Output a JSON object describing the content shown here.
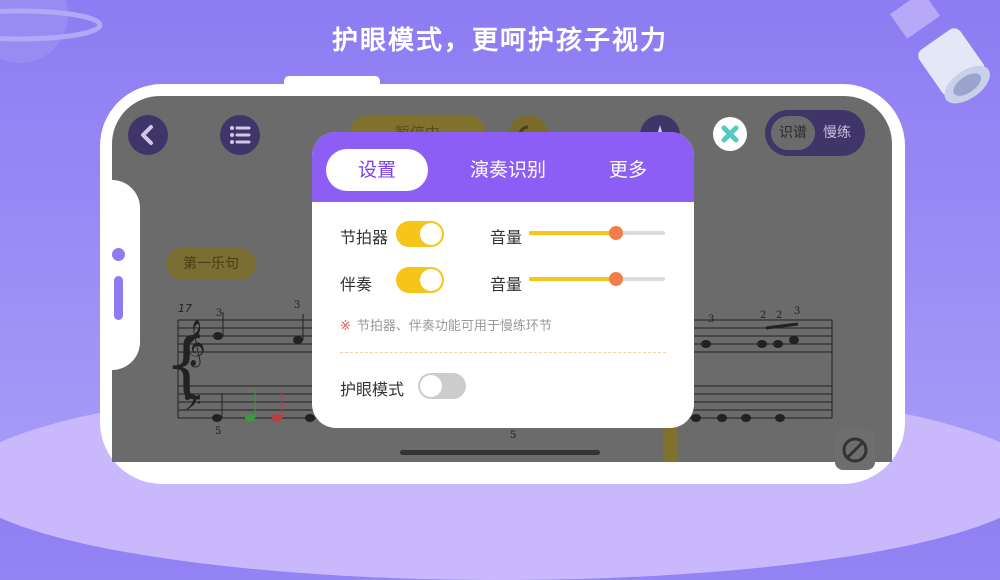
{
  "headline": "护眼模式，更呵护孩子视力",
  "app": {
    "status_pill": "暂停中",
    "mode_toggle": {
      "options": [
        "识谱",
        "慢练"
      ],
      "selected": "识谱"
    },
    "phrase_label": "第一乐句",
    "bar_number": "17"
  },
  "dialog": {
    "tabs": [
      {
        "label": "设置",
        "active": true
      },
      {
        "label": "演奏识别",
        "active": false
      },
      {
        "label": "更多",
        "active": false
      }
    ],
    "rows": [
      {
        "label": "节拍器",
        "enabled": true,
        "volume_label": "音量",
        "volume": 0.64
      },
      {
        "label": "伴奏",
        "enabled": true,
        "volume_label": "音量",
        "volume": 0.64
      }
    ],
    "note_mark": "※",
    "note": "节拍器、伴奏功能可用于慢练环节",
    "eye_protection": {
      "label": "护眼模式",
      "enabled": false
    }
  },
  "colors": {
    "background": "#8d7cf2",
    "dialog_header": "#8c5ef6",
    "toggle_on": "#f5c519",
    "slider_thumb": "#f07d4a",
    "active_tab_text": "#7a3ff0"
  },
  "icons": [
    "planet-icon",
    "satellite-icon",
    "back-arrow-icon",
    "menu-list-icon",
    "refresh-icon",
    "metronome-icon",
    "close-icon",
    "no-sound-icon"
  ]
}
